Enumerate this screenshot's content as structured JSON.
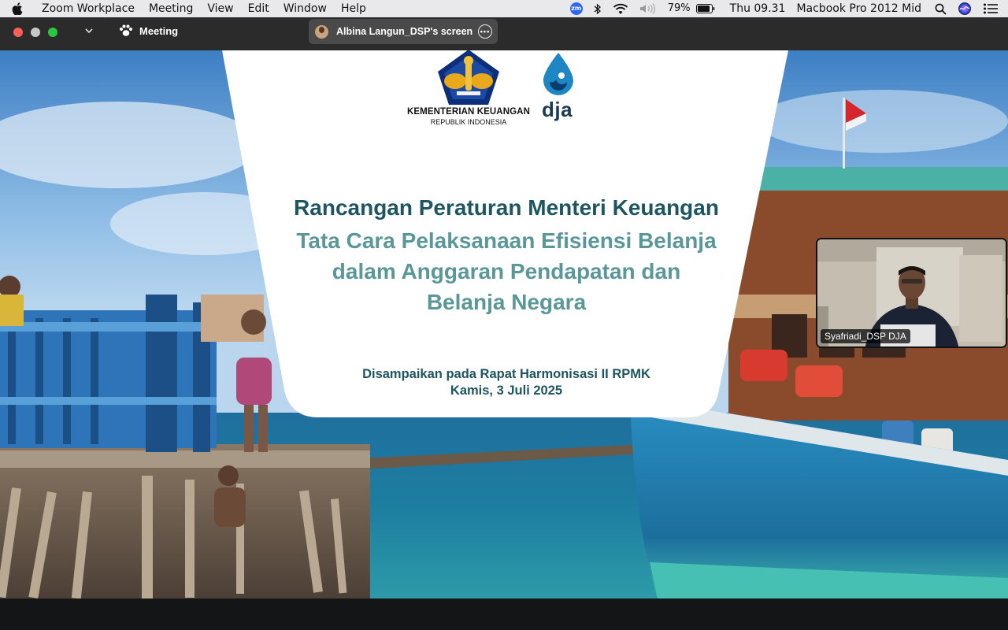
{
  "menubar": {
    "app_name": "Zoom Workplace",
    "items": [
      "Meeting",
      "View",
      "Edit",
      "Window",
      "Help"
    ],
    "zoom_badge": "zm",
    "battery_percent": "79%",
    "clock": "Thu 09.31",
    "device_name": "Macbook Pro 2012 Mid",
    "icons": [
      "apple-icon",
      "zoom-status-icon",
      "bluetooth-icon",
      "wifi-icon",
      "volume-icon",
      "battery-icon",
      "spotlight-search-icon",
      "siri-icon",
      "control-center-icon"
    ]
  },
  "titlebar": {
    "meeting_label": "Meeting",
    "share_label": "Albina Langun_DSP's screen"
  },
  "slide": {
    "logo_org_line1": "KEMENTERIAN KEUANGAN",
    "logo_org_line2": "REPUBLIK INDONESIA",
    "logo_dja": "dja",
    "title_main": "Rancangan Peraturan Menteri Keuangan",
    "title_sub": "Tata Cara Pelaksanaan Efisiensi Belanja\ndalam Anggaran Pendapatan dan\nBelanja Negara",
    "presented_at": "Disampaikan pada Rapat Harmonisasi II RPMK",
    "date": "Kamis, 3 Juli 2025"
  },
  "participant": {
    "name": "Syafriadi_DSP DJA"
  },
  "colors": {
    "title_dark_teal": "#1d5561",
    "title_light_teal": "#5a9799",
    "menubar_bg": "#e9e9ec",
    "titlebar_bg": "#2b2b2b"
  }
}
